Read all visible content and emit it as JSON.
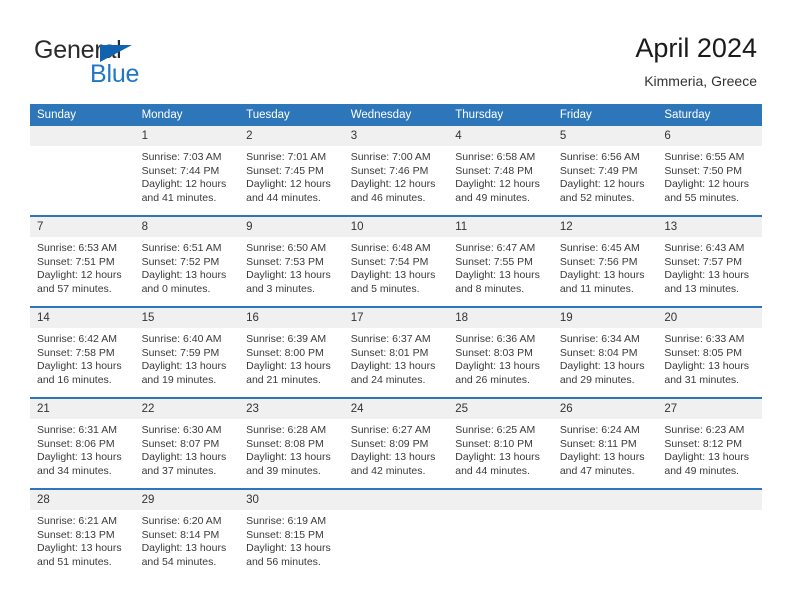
{
  "brand": {
    "name_part1": "General",
    "name_part2": "Blue"
  },
  "header": {
    "title": "April 2024",
    "location": "Kimmeria, Greece"
  },
  "colors": {
    "header_blue": "#2e76ba",
    "logo_blue": "#2176c7",
    "daynum_band": "#f0f0f0",
    "text": "#333333"
  },
  "weekday_headers": [
    "Sunday",
    "Monday",
    "Tuesday",
    "Wednesday",
    "Thursday",
    "Friday",
    "Saturday"
  ],
  "weeks": [
    [
      {
        "day": "",
        "sunrise": "",
        "sunset": "",
        "daylight_line1": "",
        "daylight_line2": ""
      },
      {
        "day": "1",
        "sunrise": "Sunrise: 7:03 AM",
        "sunset": "Sunset: 7:44 PM",
        "daylight_line1": "Daylight: 12 hours",
        "daylight_line2": "and 41 minutes."
      },
      {
        "day": "2",
        "sunrise": "Sunrise: 7:01 AM",
        "sunset": "Sunset: 7:45 PM",
        "daylight_line1": "Daylight: 12 hours",
        "daylight_line2": "and 44 minutes."
      },
      {
        "day": "3",
        "sunrise": "Sunrise: 7:00 AM",
        "sunset": "Sunset: 7:46 PM",
        "daylight_line1": "Daylight: 12 hours",
        "daylight_line2": "and 46 minutes."
      },
      {
        "day": "4",
        "sunrise": "Sunrise: 6:58 AM",
        "sunset": "Sunset: 7:48 PM",
        "daylight_line1": "Daylight: 12 hours",
        "daylight_line2": "and 49 minutes."
      },
      {
        "day": "5",
        "sunrise": "Sunrise: 6:56 AM",
        "sunset": "Sunset: 7:49 PM",
        "daylight_line1": "Daylight: 12 hours",
        "daylight_line2": "and 52 minutes."
      },
      {
        "day": "6",
        "sunrise": "Sunrise: 6:55 AM",
        "sunset": "Sunset: 7:50 PM",
        "daylight_line1": "Daylight: 12 hours",
        "daylight_line2": "and 55 minutes."
      }
    ],
    [
      {
        "day": "7",
        "sunrise": "Sunrise: 6:53 AM",
        "sunset": "Sunset: 7:51 PM",
        "daylight_line1": "Daylight: 12 hours",
        "daylight_line2": "and 57 minutes."
      },
      {
        "day": "8",
        "sunrise": "Sunrise: 6:51 AM",
        "sunset": "Sunset: 7:52 PM",
        "daylight_line1": "Daylight: 13 hours",
        "daylight_line2": "and 0 minutes."
      },
      {
        "day": "9",
        "sunrise": "Sunrise: 6:50 AM",
        "sunset": "Sunset: 7:53 PM",
        "daylight_line1": "Daylight: 13 hours",
        "daylight_line2": "and 3 minutes."
      },
      {
        "day": "10",
        "sunrise": "Sunrise: 6:48 AM",
        "sunset": "Sunset: 7:54 PM",
        "daylight_line1": "Daylight: 13 hours",
        "daylight_line2": "and 5 minutes."
      },
      {
        "day": "11",
        "sunrise": "Sunrise: 6:47 AM",
        "sunset": "Sunset: 7:55 PM",
        "daylight_line1": "Daylight: 13 hours",
        "daylight_line2": "and 8 minutes."
      },
      {
        "day": "12",
        "sunrise": "Sunrise: 6:45 AM",
        "sunset": "Sunset: 7:56 PM",
        "daylight_line1": "Daylight: 13 hours",
        "daylight_line2": "and 11 minutes."
      },
      {
        "day": "13",
        "sunrise": "Sunrise: 6:43 AM",
        "sunset": "Sunset: 7:57 PM",
        "daylight_line1": "Daylight: 13 hours",
        "daylight_line2": "and 13 minutes."
      }
    ],
    [
      {
        "day": "14",
        "sunrise": "Sunrise: 6:42 AM",
        "sunset": "Sunset: 7:58 PM",
        "daylight_line1": "Daylight: 13 hours",
        "daylight_line2": "and 16 minutes."
      },
      {
        "day": "15",
        "sunrise": "Sunrise: 6:40 AM",
        "sunset": "Sunset: 7:59 PM",
        "daylight_line1": "Daylight: 13 hours",
        "daylight_line2": "and 19 minutes."
      },
      {
        "day": "16",
        "sunrise": "Sunrise: 6:39 AM",
        "sunset": "Sunset: 8:00 PM",
        "daylight_line1": "Daylight: 13 hours",
        "daylight_line2": "and 21 minutes."
      },
      {
        "day": "17",
        "sunrise": "Sunrise: 6:37 AM",
        "sunset": "Sunset: 8:01 PM",
        "daylight_line1": "Daylight: 13 hours",
        "daylight_line2": "and 24 minutes."
      },
      {
        "day": "18",
        "sunrise": "Sunrise: 6:36 AM",
        "sunset": "Sunset: 8:03 PM",
        "daylight_line1": "Daylight: 13 hours",
        "daylight_line2": "and 26 minutes."
      },
      {
        "day": "19",
        "sunrise": "Sunrise: 6:34 AM",
        "sunset": "Sunset: 8:04 PM",
        "daylight_line1": "Daylight: 13 hours",
        "daylight_line2": "and 29 minutes."
      },
      {
        "day": "20",
        "sunrise": "Sunrise: 6:33 AM",
        "sunset": "Sunset: 8:05 PM",
        "daylight_line1": "Daylight: 13 hours",
        "daylight_line2": "and 31 minutes."
      }
    ],
    [
      {
        "day": "21",
        "sunrise": "Sunrise: 6:31 AM",
        "sunset": "Sunset: 8:06 PM",
        "daylight_line1": "Daylight: 13 hours",
        "daylight_line2": "and 34 minutes."
      },
      {
        "day": "22",
        "sunrise": "Sunrise: 6:30 AM",
        "sunset": "Sunset: 8:07 PM",
        "daylight_line1": "Daylight: 13 hours",
        "daylight_line2": "and 37 minutes."
      },
      {
        "day": "23",
        "sunrise": "Sunrise: 6:28 AM",
        "sunset": "Sunset: 8:08 PM",
        "daylight_line1": "Daylight: 13 hours",
        "daylight_line2": "and 39 minutes."
      },
      {
        "day": "24",
        "sunrise": "Sunrise: 6:27 AM",
        "sunset": "Sunset: 8:09 PM",
        "daylight_line1": "Daylight: 13 hours",
        "daylight_line2": "and 42 minutes."
      },
      {
        "day": "25",
        "sunrise": "Sunrise: 6:25 AM",
        "sunset": "Sunset: 8:10 PM",
        "daylight_line1": "Daylight: 13 hours",
        "daylight_line2": "and 44 minutes."
      },
      {
        "day": "26",
        "sunrise": "Sunrise: 6:24 AM",
        "sunset": "Sunset: 8:11 PM",
        "daylight_line1": "Daylight: 13 hours",
        "daylight_line2": "and 47 minutes."
      },
      {
        "day": "27",
        "sunrise": "Sunrise: 6:23 AM",
        "sunset": "Sunset: 8:12 PM",
        "daylight_line1": "Daylight: 13 hours",
        "daylight_line2": "and 49 minutes."
      }
    ],
    [
      {
        "day": "28",
        "sunrise": "Sunrise: 6:21 AM",
        "sunset": "Sunset: 8:13 PM",
        "daylight_line1": "Daylight: 13 hours",
        "daylight_line2": "and 51 minutes."
      },
      {
        "day": "29",
        "sunrise": "Sunrise: 6:20 AM",
        "sunset": "Sunset: 8:14 PM",
        "daylight_line1": "Daylight: 13 hours",
        "daylight_line2": "and 54 minutes."
      },
      {
        "day": "30",
        "sunrise": "Sunrise: 6:19 AM",
        "sunset": "Sunset: 8:15 PM",
        "daylight_line1": "Daylight: 13 hours",
        "daylight_line2": "and 56 minutes."
      },
      {
        "day": "",
        "sunrise": "",
        "sunset": "",
        "daylight_line1": "",
        "daylight_line2": ""
      },
      {
        "day": "",
        "sunrise": "",
        "sunset": "",
        "daylight_line1": "",
        "daylight_line2": ""
      },
      {
        "day": "",
        "sunrise": "",
        "sunset": "",
        "daylight_line1": "",
        "daylight_line2": ""
      },
      {
        "day": "",
        "sunrise": "",
        "sunset": "",
        "daylight_line1": "",
        "daylight_line2": ""
      }
    ]
  ]
}
